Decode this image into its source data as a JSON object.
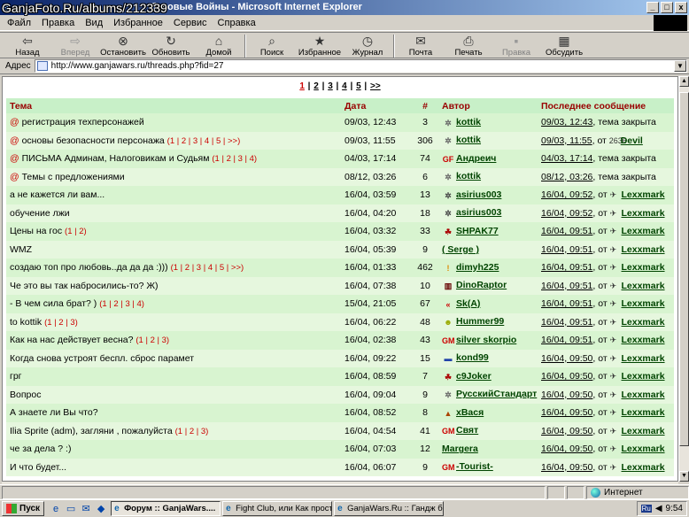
{
  "window": {
    "title": "басовые Войны - Microsoft Internet Explorer",
    "watermark": "GanjaFoto.Ru/albums/212339",
    "controls": [
      "_",
      "□",
      "x"
    ]
  },
  "menu": [
    "Файл",
    "Правка",
    "Вид",
    "Избранное",
    "Сервис",
    "Справка"
  ],
  "toolbar": {
    "back": "Назад",
    "forward": "Вперед",
    "stop": "Остановить",
    "refresh": "Обновить",
    "home": "Домой",
    "search": "Поиск",
    "favorites": "Избранное",
    "history": "Журнал",
    "mail": "Почта",
    "print": "Печать",
    "edit": "Правка",
    "discuss": "Обсудить"
  },
  "address": {
    "label": "Адрес",
    "url": "http://www.ganjawars.ru/threads.php?fid=27"
  },
  "pager": {
    "pages": [
      "1",
      "2",
      "3",
      "4",
      "5",
      ">>"
    ],
    "separator": "|"
  },
  "table": {
    "headers": {
      "topic": "Тема",
      "date": "Дата",
      "count": "#",
      "author": "Автор",
      "last": "Последнее сообщение"
    },
    "rows": [
      {
        "pin": "@",
        "topic": "регистрация техперсонажей",
        "pages": "",
        "date": "09/03, 12:43",
        "count": "3",
        "author": "kottik",
        "av": "✲",
        "avc": "#666",
        "last_time": "09/03, 12:43",
        "last_sep": ", тема закрыта",
        "last_author": "",
        "last_ico": ""
      },
      {
        "pin": "@",
        "topic": "основы безопасности персонажа",
        "pages": "(1 | 2 | 3 | 4 | 5 | >>)",
        "date": "09/03, 11:55",
        "count": "306",
        "author": "kottik",
        "av": "✲",
        "avc": "#666",
        "last_time": "09/03, 11:55",
        "last_sep": ", от",
        "last_author": "Devil",
        "last_ico": "2636"
      },
      {
        "pin": "@",
        "topic": "ПИСЬМА Админам, Налоговикам и Судьям",
        "pages": "(1 | 2 | 3 | 4)",
        "date": "04/03, 17:14",
        "count": "74",
        "author": "Андреич",
        "av": "GF",
        "avc": "#c00",
        "last_time": "04/03, 17:14",
        "last_sep": ", тема закрыта",
        "last_author": "",
        "last_ico": ""
      },
      {
        "pin": "@",
        "topic": "Темы с предложениями",
        "pages": "",
        "date": "08/12, 03:26",
        "count": "6",
        "author": "kottik",
        "av": "✲",
        "avc": "#666",
        "last_time": "08/12, 03:26",
        "last_sep": ", тема закрыта",
        "last_author": "",
        "last_ico": ""
      },
      {
        "pin": "",
        "topic": "а не кажется ли вам...",
        "pages": "",
        "date": "16/04, 03:59",
        "count": "13",
        "author": "asirius003",
        "av": "✲",
        "avc": "#444",
        "last_time": "16/04, 09:52",
        "last_sep": ", от",
        "last_author": "Lexxmark",
        "last_ico": "✈"
      },
      {
        "pin": "",
        "topic": "обучение лжи",
        "pages": "",
        "date": "16/04, 04:20",
        "count": "18",
        "author": "asirius003",
        "av": "✲",
        "avc": "#444",
        "last_time": "16/04, 09:52",
        "last_sep": ", от",
        "last_author": "Lexxmark",
        "last_ico": "✈"
      },
      {
        "pin": "",
        "topic": "Цены на гос",
        "pages": "(1 | 2)",
        "date": "16/04, 03:32",
        "count": "33",
        "author": "SHPAK77",
        "av": "☘",
        "avc": "#a00",
        "last_time": "16/04, 09:51",
        "last_sep": ", от",
        "last_author": "Lexxmark",
        "last_ico": "✈"
      },
      {
        "pin": "",
        "topic": "WMZ",
        "pages": "",
        "date": "16/04, 05:39",
        "count": "9",
        "author": "( Serge )",
        "av": "",
        "avc": "#000",
        "last_time": "16/04, 09:51",
        "last_sep": ", от",
        "last_author": "Lexxmark",
        "last_ico": "✈"
      },
      {
        "pin": "",
        "topic": "создаю топ про любовь..да да да :)))",
        "pages": "(1 | 2 | 3 | 4 | 5 | >>)",
        "date": "16/04, 01:33",
        "count": "462",
        "author": "dimyh225",
        "av": "!",
        "avc": "#d80",
        "last_time": "16/04, 09:51",
        "last_sep": ", от",
        "last_author": "Lexxmark",
        "last_ico": "✈"
      },
      {
        "pin": "",
        "topic": "Че это вы так набросились-то? Ж)",
        "pages": "",
        "date": "16/04, 07:38",
        "count": "10",
        "author": "DinoRaptor",
        "av": "▥",
        "avc": "#600",
        "last_time": "16/04, 09:51",
        "last_sep": ", от",
        "last_author": "Lexxmark",
        "last_ico": "✈"
      },
      {
        "pin": "",
        "topic": "- В чем сила брат? )",
        "pages": "(1 | 2 | 3 | 4)",
        "date": "15/04, 21:05",
        "count": "67",
        "author": "Sk(A)",
        "av": "«",
        "avc": "#c00",
        "last_time": "16/04, 09:51",
        "last_sep": ", от",
        "last_author": "Lexxmark",
        "last_ico": "✈"
      },
      {
        "pin": "",
        "topic": "to kottik",
        "pages": "(1 | 2 | 3)",
        "date": "16/04, 06:22",
        "count": "48",
        "author": "Hummer99",
        "av": "☻",
        "avc": "#9a0",
        "last_time": "16/04, 09:51",
        "last_sep": ", от",
        "last_author": "Lexxmark",
        "last_ico": "✈"
      },
      {
        "pin": "",
        "topic": "Как на нас действует весна?",
        "pages": "(1 | 2 | 3)",
        "date": "16/04, 02:38",
        "count": "43",
        "author": "silver skorpio",
        "av": "GM",
        "avc": "#c00",
        "last_time": "16/04, 09:51",
        "last_sep": ", от",
        "last_author": "Lexxmark",
        "last_ico": "✈"
      },
      {
        "pin": "",
        "topic": "Когда снова устроят беспл. сброс парамет",
        "pages": "",
        "date": "16/04, 09:22",
        "count": "15",
        "author": "kond99",
        "av": "▬",
        "avc": "#24a",
        "last_time": "16/04, 09:50",
        "last_sep": ", от",
        "last_author": "Lexxmark",
        "last_ico": "✈"
      },
      {
        "pin": "",
        "topic": "грг",
        "pages": "",
        "date": "16/04, 08:59",
        "count": "7",
        "author": "c9Joker",
        "av": "☘",
        "avc": "#a00",
        "last_time": "16/04, 09:50",
        "last_sep": ", от",
        "last_author": "Lexxmark",
        "last_ico": "✈"
      },
      {
        "pin": "",
        "topic": "Вопрос",
        "pages": "",
        "date": "16/04, 09:04",
        "count": "9",
        "author": "РусскийСтандарт",
        "av": "✲",
        "avc": "#666",
        "last_time": "16/04, 09:50",
        "last_sep": ", от",
        "last_author": "Lexxmark",
        "last_ico": "✈"
      },
      {
        "pin": "",
        "topic": "А знаете ли Вы что?",
        "pages": "",
        "date": "16/04, 08:52",
        "count": "8",
        "author": "хВася",
        "av": "▲",
        "avc": "#a40",
        "last_time": "16/04, 09:50",
        "last_sep": ", от",
        "last_author": "Lexxmark",
        "last_ico": "✈"
      },
      {
        "pin": "",
        "topic": "Ilia Sprite (adm), загляни , пожалуйста",
        "pages": "(1 | 2 | 3)",
        "date": "16/04, 04:54",
        "count": "41",
        "author": "Свят",
        "av": "GM",
        "avc": "#c00",
        "last_time": "16/04, 09:50",
        "last_sep": ", от",
        "last_author": "Lexxmark",
        "last_ico": "✈"
      },
      {
        "pin": "",
        "topic": "че за дела ? :)",
        "pages": "",
        "date": "16/04, 07:03",
        "count": "12",
        "author": "Margera",
        "av": "",
        "avc": "#000",
        "last_time": "16/04, 09:50",
        "last_sep": ", от",
        "last_author": "Lexxmark",
        "last_ico": "✈"
      },
      {
        "pin": "",
        "topic": "И что будет...",
        "pages": "",
        "date": "16/04, 06:07",
        "count": "9",
        "author": "-Tourist-",
        "av": "GM",
        "avc": "#c00",
        "last_time": "16/04, 09:50",
        "last_sep": ", от",
        "last_author": "Lexxmark",
        "last_ico": "✈"
      }
    ]
  },
  "status": {
    "zone": "Интернет"
  },
  "taskbar": {
    "start": "Пуск",
    "tasks": [
      "Форум :: GanjaWars....",
      "Fight Club, или Как прост...",
      "GanjaWars.Ru :: Гандж б..."
    ],
    "lang": "Ru",
    "time": "9:54"
  },
  "colors": {
    "header_bg": "#c8f0c8",
    "row_bg": "#d8f4d0",
    "accent": "#cc0000",
    "author": "#004400"
  }
}
